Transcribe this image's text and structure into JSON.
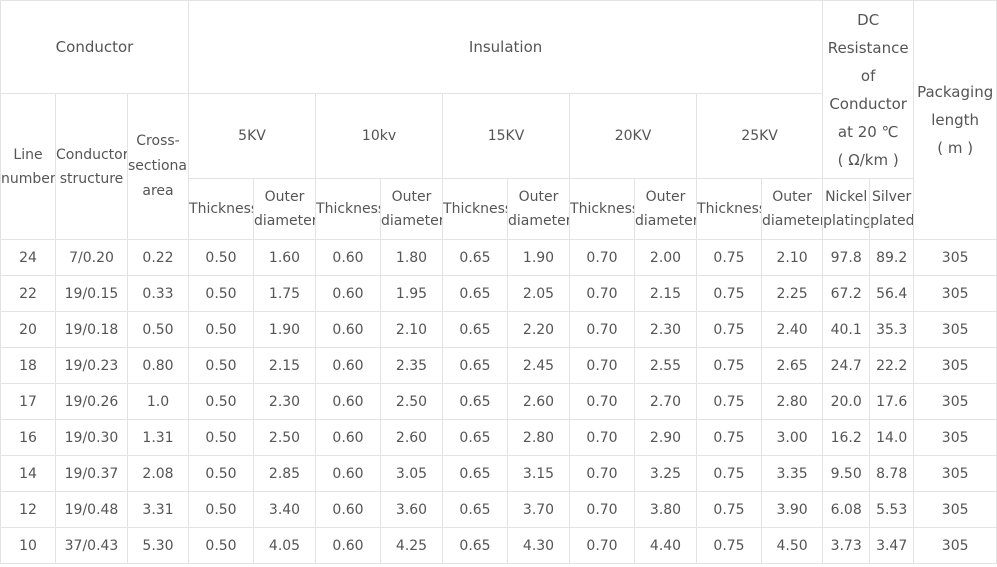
{
  "header": {
    "conductor": "Conductor",
    "insulation": "Insulation",
    "dc_resistance": "DC\nResistance\nof\nConductor\nat 20 ℃\n( Ω/km )",
    "packaging": "Packaging\nlength\n( m )",
    "line_number": "Line\nnumber",
    "conductor_structure": "Conductor\nstructure",
    "cross_sectional_area": "Cross-\nsectional\narea",
    "kv_groups": [
      "5KV",
      "10kv",
      "15KV",
      "20KV",
      "25KV"
    ],
    "thickness": "Thickness",
    "outer_diameter": "Outer\ndiameter",
    "nickel_plating": "Nickel\nplating",
    "silver_plated": "Silver\nplated"
  },
  "rows": [
    [
      "24",
      "7/0.20",
      "0.22",
      "0.50",
      "1.60",
      "0.60",
      "1.80",
      "0.65",
      "1.90",
      "0.70",
      "2.00",
      "0.75",
      "2.10",
      "97.8",
      "89.2",
      "305"
    ],
    [
      "22",
      "19/0.15",
      "0.33",
      "0.50",
      "1.75",
      "0.60",
      "1.95",
      "0.65",
      "2.05",
      "0.70",
      "2.15",
      "0.75",
      "2.25",
      "67.2",
      "56.4",
      "305"
    ],
    [
      "20",
      "19/0.18",
      "0.50",
      "0.50",
      "1.90",
      "0.60",
      "2.10",
      "0.65",
      "2.20",
      "0.70",
      "2.30",
      "0.75",
      "2.40",
      "40.1",
      "35.3",
      "305"
    ],
    [
      "18",
      "19/0.23",
      "0.80",
      "0.50",
      "2.15",
      "0.60",
      "2.35",
      "0.65",
      "2.45",
      "0.70",
      "2.55",
      "0.75",
      "2.65",
      "24.7",
      "22.2",
      "305"
    ],
    [
      "17",
      "19/0.26",
      "1.0",
      "0.50",
      "2.30",
      "0.60",
      "2.50",
      "0.65",
      "2.60",
      "0.70",
      "2.70",
      "0.75",
      "2.80",
      "20.0",
      "17.6",
      "305"
    ],
    [
      "16",
      "19/0.30",
      "1.31",
      "0.50",
      "2.50",
      "0.60",
      "2.60",
      "0.65",
      "2.80",
      "0.70",
      "2.90",
      "0.75",
      "3.00",
      "16.2",
      "14.0",
      "305"
    ],
    [
      "14",
      "19/0.37",
      "2.08",
      "0.50",
      "2.85",
      "0.60",
      "3.05",
      "0.65",
      "3.15",
      "0.70",
      "3.25",
      "0.75",
      "3.35",
      "9.50",
      "8.78",
      "305"
    ],
    [
      "12",
      "19/0.48",
      "3.31",
      "0.50",
      "3.40",
      "0.60",
      "3.60",
      "0.65",
      "3.70",
      "0.70",
      "3.80",
      "0.75",
      "3.90",
      "6.08",
      "5.53",
      "305"
    ],
    [
      "10",
      "37/0.43",
      "5.30",
      "0.50",
      "4.05",
      "0.60",
      "4.25",
      "0.65",
      "4.30",
      "0.70",
      "4.40",
      "0.75",
      "4.50",
      "3.73",
      "3.47",
      "305"
    ]
  ]
}
